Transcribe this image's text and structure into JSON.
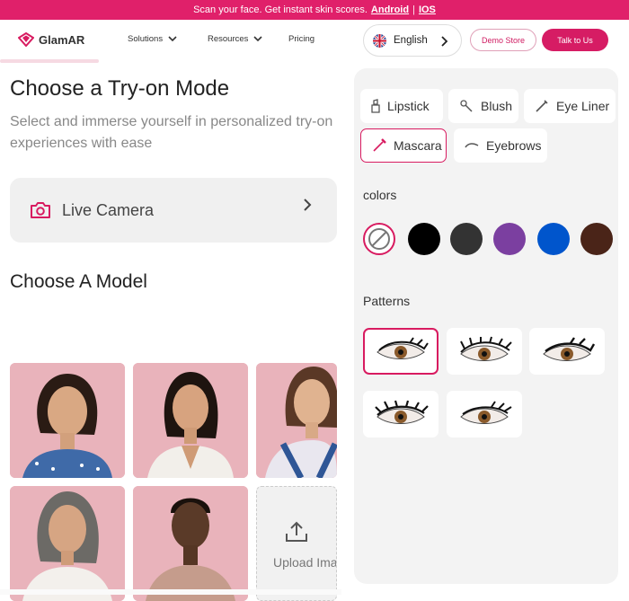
{
  "banner": {
    "text": "Scan your face. Get instant skin scores.",
    "android": "Android",
    "sep": "|",
    "ios": "IOS"
  },
  "header": {
    "brand": "GlamAR",
    "nav": [
      {
        "label": "Solutions",
        "has_menu": true
      },
      {
        "label": "Resources",
        "has_menu": true
      },
      {
        "label": "Pricing",
        "has_menu": false
      }
    ],
    "language": "English",
    "demo_button": "Demo Store",
    "talk_button": "Talk to Us"
  },
  "tryon": {
    "title": "Choose a Try-on Mode",
    "subtitle": "Select and immerse yourself in personalized try-on experiences with ease",
    "live_camera": "Live Camera"
  },
  "models": {
    "title": "Choose A Model",
    "upload_label": "Upload Ima"
  },
  "panel": {
    "categories": [
      {
        "label": "Lipstick",
        "icon": "lipstick-icon",
        "active": false
      },
      {
        "label": "Blush",
        "icon": "blush-icon",
        "active": false
      },
      {
        "label": "Eye Liner",
        "icon": "eyeliner-icon",
        "active": false
      },
      {
        "label": "Mascara",
        "icon": "mascara-icon",
        "active": true
      },
      {
        "label": "Eyebrows",
        "icon": "eyebrow-icon",
        "active": false
      }
    ],
    "colors_label": "colors",
    "colors": [
      "none",
      "#000000",
      "#333333",
      "#7b3fa0",
      "#0055cc",
      "#4a2418"
    ],
    "patterns_label": "Patterns",
    "selected_pattern": 1
  },
  "theme": {
    "accent": "#d81b60",
    "banner": "#e0206a"
  }
}
